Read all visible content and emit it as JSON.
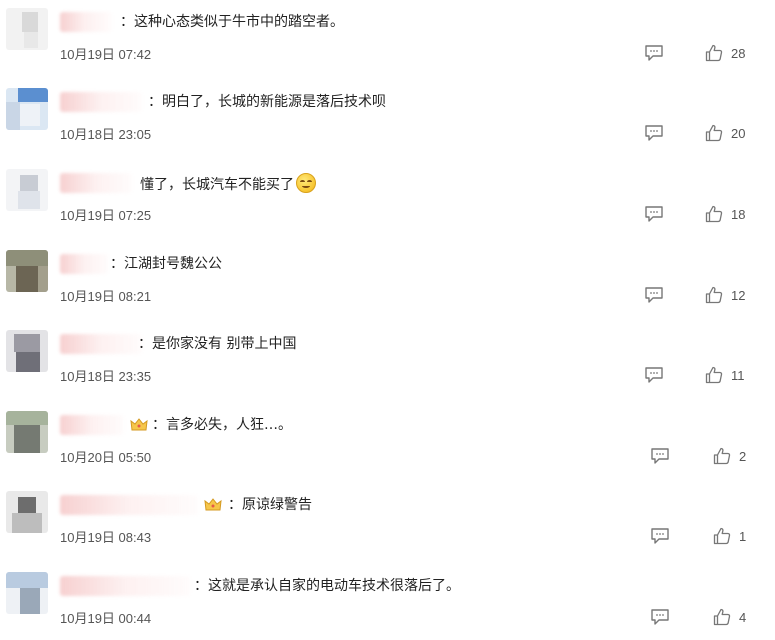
{
  "comments": [
    {
      "text": "这种心态类似于牛市中的踏空者。",
      "time": "10月19日 07:42",
      "likes": "28",
      "reply_icon": "comment-icon",
      "like_icon": "thumbs-up-icon"
    },
    {
      "text": "明白了，长城的新能源是落后技术呗",
      "time": "10月18日 23:05",
      "likes": "20",
      "reply_icon": "comment-icon",
      "like_icon": "thumbs-up-icon"
    },
    {
      "text": "懂了，长城汽车不能买了",
      "time": "10月19日 07:25",
      "likes": "18",
      "reply_icon": "comment-icon",
      "like_icon": "thumbs-up-icon",
      "emoji": "smile-emoji"
    },
    {
      "text": "江湖封号魏公公",
      "time": "10月19日 08:21",
      "likes": "12",
      "reply_icon": "comment-icon",
      "like_icon": "thumbs-up-icon"
    },
    {
      "text": "是你家没有 别带上中国",
      "time": "10月18日 23:35",
      "likes": "11",
      "reply_icon": "comment-icon",
      "like_icon": "thumbs-up-icon"
    },
    {
      "text": "言多必失，人狂…。",
      "time": "10月20日 05:50",
      "likes": "2",
      "reply_icon": "comment-icon",
      "like_icon": "thumbs-up-icon",
      "badge": "crown-icon"
    },
    {
      "text": "原谅绿警告",
      "time": "10月19日 08:43",
      "likes": "1",
      "reply_icon": "comment-icon",
      "like_icon": "thumbs-up-icon",
      "badge": "crown-icon"
    },
    {
      "text": "这就是承认自家的电动车技术很落后了。",
      "time": "10月19日 00:44",
      "likes": "4",
      "reply_icon": "comment-icon",
      "like_icon": "thumbs-up-icon"
    }
  ],
  "separator": "："
}
